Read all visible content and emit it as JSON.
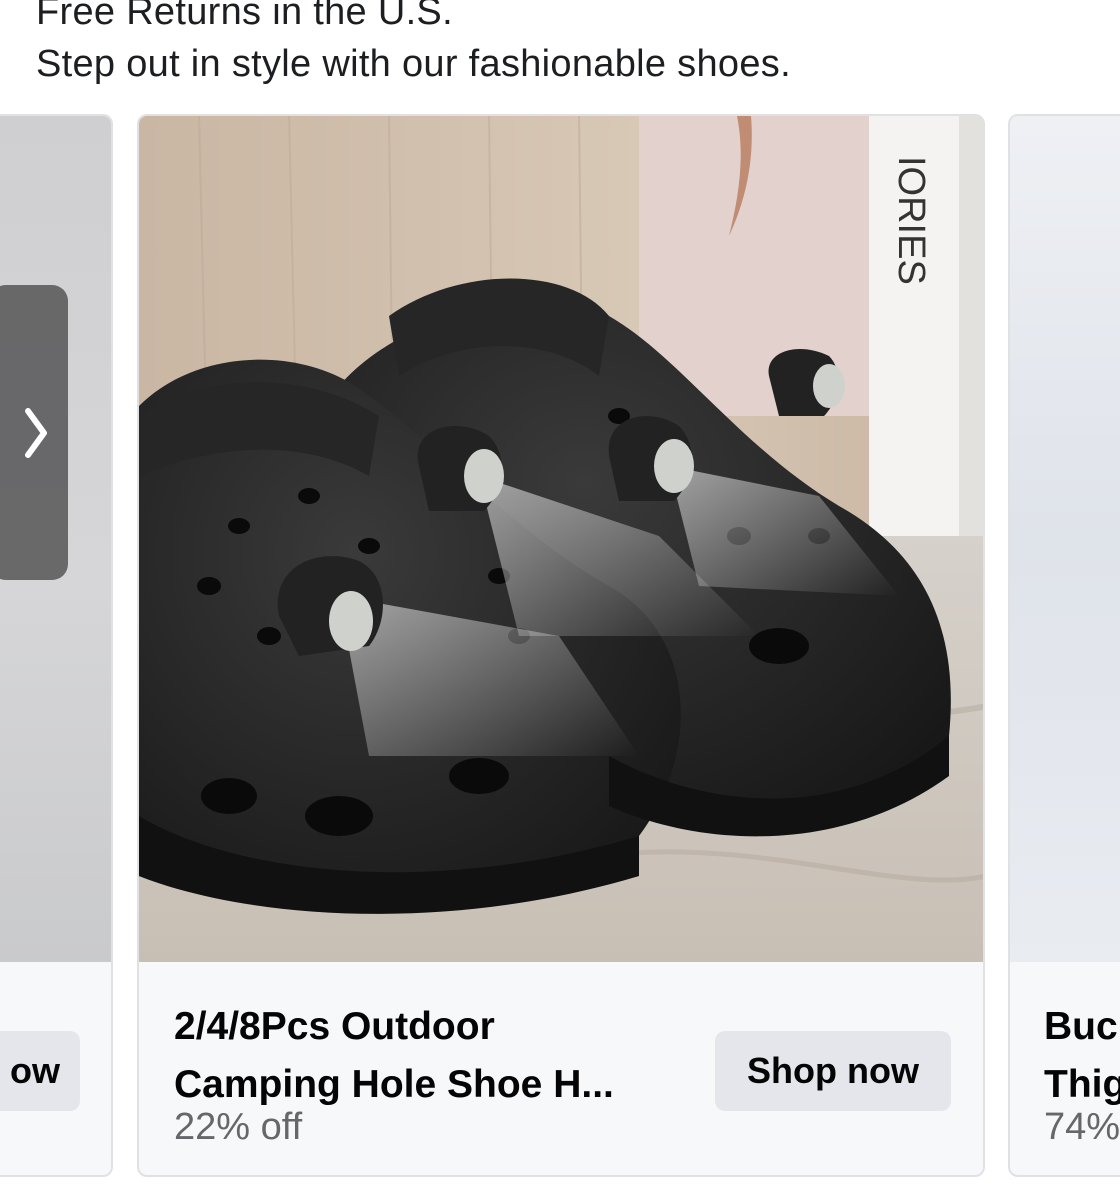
{
  "ad": {
    "line1": "Free Returns in the U.S.",
    "line2": "Step out in style with our fashionable shoes."
  },
  "cards": {
    "left": {
      "button_partial": "ow"
    },
    "main": {
      "title_line1": "2/4/8Pcs Outdoor",
      "title_line2": "Camping Hole Shoe H...",
      "discount": "22% off",
      "shop_label": "Shop now",
      "image_text": "IORIES"
    },
    "right": {
      "title_line1": "Buc",
      "title_line2": "Thig",
      "discount": "74%"
    }
  },
  "icons": {
    "carousel_prev": "chevron-right-icon"
  },
  "colors": {
    "button_bg": "#e4e6eb",
    "card_bg": "#f7f8fa",
    "secondary_text": "#65676b"
  }
}
